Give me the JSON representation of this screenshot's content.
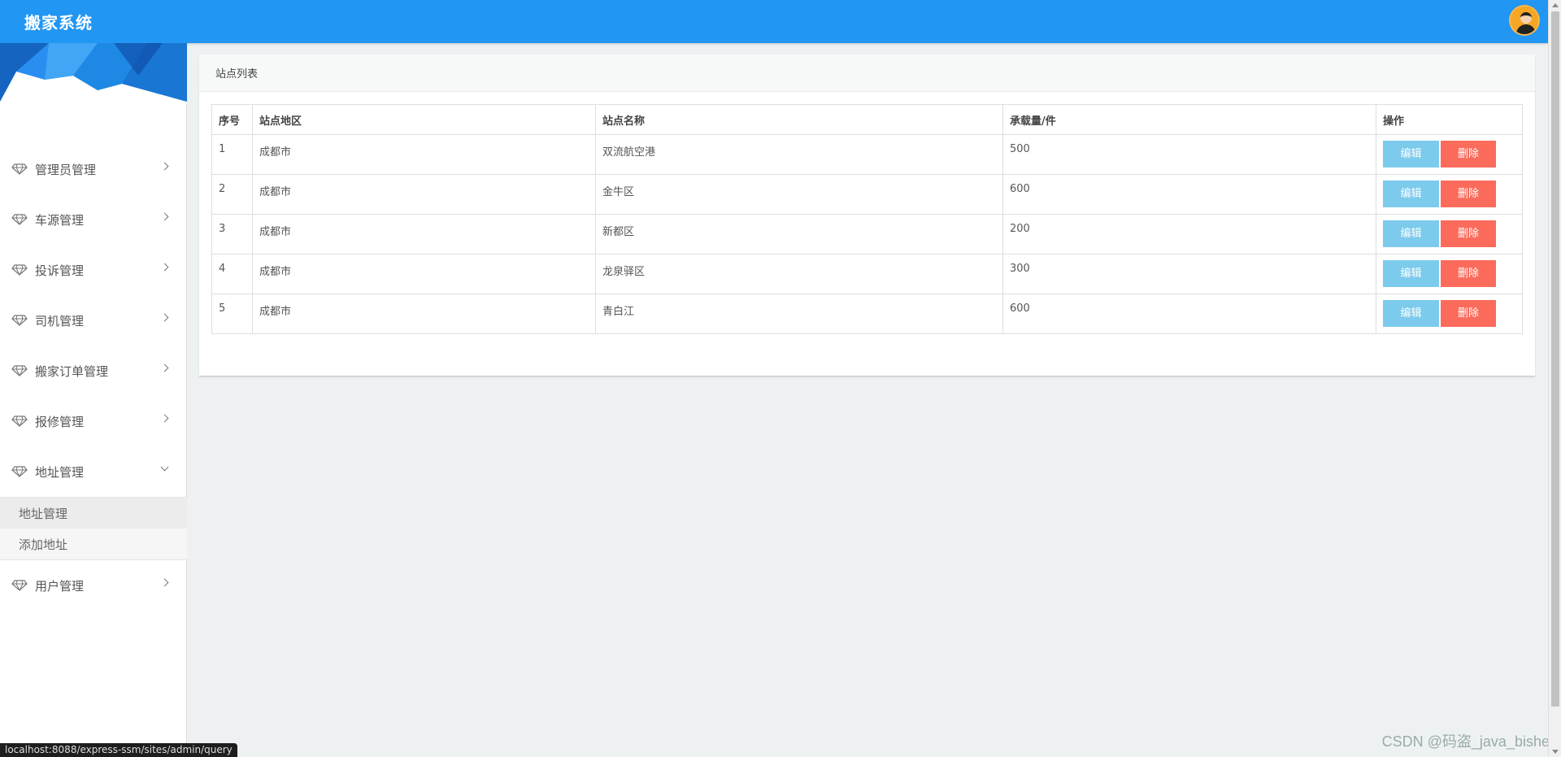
{
  "header": {
    "brand": "搬家系统"
  },
  "sidebar": {
    "items": [
      {
        "label": "管理员管理"
      },
      {
        "label": "车源管理"
      },
      {
        "label": "投诉管理"
      },
      {
        "label": "司机管理"
      },
      {
        "label": "搬家订单管理"
      },
      {
        "label": "报修管理"
      },
      {
        "label": "地址管理",
        "expanded": true,
        "children": [
          {
            "label": "地址管理",
            "active": true
          },
          {
            "label": "添加地址"
          }
        ]
      },
      {
        "label": "用户管理"
      }
    ]
  },
  "panel": {
    "title": "站点列表",
    "columns": [
      "序号",
      "站点地区",
      "站点名称",
      "承载量/件",
      "操作"
    ],
    "rows": [
      {
        "id": "1",
        "region": "成都市",
        "name": "双流航空港",
        "capacity": "500"
      },
      {
        "id": "2",
        "region": "成都市",
        "name": "金牛区",
        "capacity": "600"
      },
      {
        "id": "3",
        "region": "成都市",
        "name": "新都区",
        "capacity": "200"
      },
      {
        "id": "4",
        "region": "成都市",
        "name": "龙泉驿区",
        "capacity": "300"
      },
      {
        "id": "5",
        "region": "成都市",
        "name": "青白江",
        "capacity": "600"
      }
    ],
    "edit_label": "编辑",
    "delete_label": "删除"
  },
  "status_url": "localhost:8088/express-ssm/sites/admin/query",
  "watermark": "CSDN @码盗_java_bishe",
  "colors": {
    "header": "#2196f3",
    "edit": "#7ccbec",
    "delete": "#fb6b5b"
  }
}
